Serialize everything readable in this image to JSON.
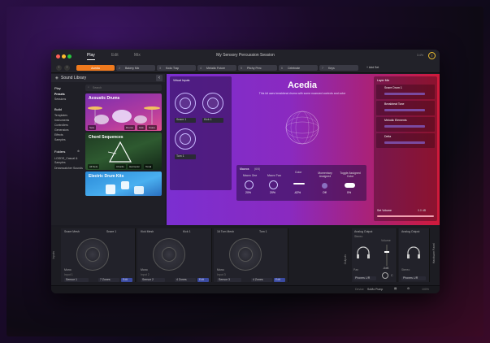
{
  "window": {
    "title": "My Sensory Percussion Session",
    "tabs": [
      "Play",
      "Edit",
      "Mix"
    ],
    "avatar_initial": "T",
    "cpu": "3.4%"
  },
  "macro_tabs": {
    "items": [
      {
        "num": "",
        "label": "Acedia"
      },
      {
        "num": "2",
        "label": "Bakery Mix"
      },
      {
        "num": "3",
        "label": "Kodo Trap"
      },
      {
        "num": "4",
        "label": "Melodic Future"
      },
      {
        "num": "5",
        "label": "Pitchy Perc"
      },
      {
        "num": "6",
        "label": "Celebrate"
      },
      {
        "num": "7",
        "label": "Keys"
      }
    ],
    "add_set": "+ Add Set"
  },
  "sidebar": {
    "title": "Sound Library",
    "search_placeholder": "Search",
    "play": "Play",
    "presets": "Presets",
    "sessions": "Sessions",
    "build": "Build",
    "build_items": [
      "Templates",
      "Instruments",
      "Controllers",
      "Generators",
      "Effects",
      "Samples"
    ],
    "folders": "Folders",
    "folder_items": [
      "LOGDS_Casual & Samples",
      "Dreamcatcher Sounds"
    ],
    "tiles": [
      {
        "title": "Acoustic Drums",
        "tags": [
          "Sets",
          "Drums",
          "Kick",
          "Snare"
        ]
      },
      {
        "title": "Chord Sequences",
        "tags": [
          "All Sets",
          "Chords",
          "Harmonic",
          "Tonal"
        ]
      },
      {
        "title": "Electric Drum Kits",
        "tags": []
      }
    ]
  },
  "virtual_inputs": {
    "title": "Virtual Inputs",
    "snare": "Snare 1",
    "kick": "Kick 1",
    "tom": "Tom 1"
  },
  "preset": {
    "name": "Acedia",
    "desc": "This kit uses breakbeat drums with some nuanced controls and color",
    "macros_title": "Macros",
    "macros_count": "(6/6)",
    "macros": [
      {
        "label": "Macro One",
        "value": "20%"
      },
      {
        "label": "Macro Two",
        "value": "20%"
      },
      {
        "label": "Color",
        "value": "-62%"
      },
      {
        "label": "Momentary Assigned",
        "value": "Off"
      },
      {
        "label": "Toggle Assigned Color",
        "value": "0%"
      }
    ]
  },
  "layer_mix": {
    "title": "Layer Mix",
    "layers": [
      "Snare Drum 1",
      "Breakbeat Tone",
      "Melodic Elements",
      "Delta"
    ],
    "set_volume": "Set Volume",
    "set_volume_value": "0.0 dB"
  },
  "inputs": [
    {
      "name": "Snare Mesh",
      "assign": "Snare 1",
      "mono": "Mono",
      "input_label": "Input 1",
      "sensor": "Sensor 1",
      "zones": "7 Zones",
      "edit": "Edit",
      "vel": "127"
    },
    {
      "name": "Kick Mesh",
      "assign": "Kick 1",
      "mono": "Mono",
      "input_label": "Input 2",
      "sensor": "Sensor 2",
      "zones": "4 Zones",
      "edit": "Edit",
      "vel": "127"
    },
    {
      "name": "16 Tom Mesh",
      "assign": "Tom 1",
      "mono": "Mono",
      "input_label": "Input 3",
      "sensor": "Sensor 3",
      "zones": "4 Zones",
      "edit": "Edit",
      "vel": "127"
    }
  ],
  "inputs_label": "Inputs",
  "outputs_label": "Outputs",
  "hardware_panel": "Hardware Panel",
  "outputs": {
    "a": {
      "name": "Analog Output",
      "stereo": "Stereo",
      "source": "Phones L/R",
      "volume_label": "Volume",
      "meter": "-6dB",
      "pan_label": "Pan",
      "pan": "C"
    },
    "b": {
      "name": "Analog Output",
      "stereo": "Stereo",
      "source": "Phones L/R"
    }
  },
  "status": {
    "device_label": "Device",
    "device": "SoMo Pump",
    "zoom": "100%",
    "colors": {
      "accent": "#f07a1e",
      "purple": "#7b2fd1",
      "pink": "#d01a3a",
      "blue": "#4a8cff"
    }
  }
}
